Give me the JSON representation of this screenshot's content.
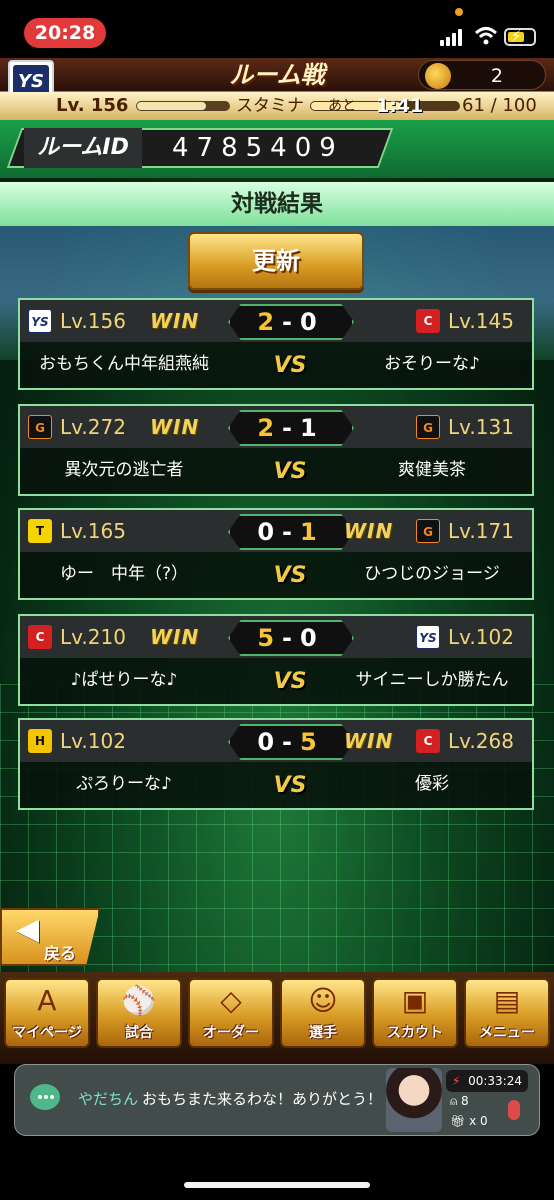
{
  "status_bar": {
    "time": "20:28"
  },
  "header": {
    "title": "ルーム戦",
    "team_emblem": "YS",
    "coin_count": "2",
    "level": "Lv. 156",
    "xp_fraction": 0.75,
    "stamina_label": "スタミナ",
    "stamina_timer_prefix": "あと",
    "stamina_timer": "1:41",
    "stamina_count": "61 / 100",
    "stamina_fraction": 0.61
  },
  "room": {
    "label": "ルームID",
    "id": "4785409"
  },
  "results": {
    "title": "対戦結果",
    "update_label": "更新",
    "vs_label": "VS",
    "win_label": "WIN"
  },
  "matches": [
    {
      "left": {
        "emblem": "YS",
        "level": "Lv.156",
        "name": "おもちくん中年組燕純"
      },
      "right": {
        "emblem": "C",
        "level": "Lv.145",
        "name": "おそりーな♪"
      },
      "score_left": "2",
      "score_right": "0",
      "winner": "left"
    },
    {
      "left": {
        "emblem": "G",
        "level": "Lv.272",
        "name": "異次元の逃亡者"
      },
      "right": {
        "emblem": "G",
        "level": "Lv.131",
        "name": "爽健美茶"
      },
      "score_left": "2",
      "score_right": "1",
      "winner": "left"
    },
    {
      "left": {
        "emblem": "T",
        "level": "Lv.165",
        "name": "ゆー　中年（?）"
      },
      "right": {
        "emblem": "G",
        "level": "Lv.171",
        "name": "ひつじのジョージ"
      },
      "score_left": "0",
      "score_right": "1",
      "winner": "right"
    },
    {
      "left": {
        "emblem": "C",
        "level": "Lv.210",
        "name": "♪ぱせりーな♪"
      },
      "right": {
        "emblem": "YS",
        "level": "Lv.102",
        "name": "サイニーしか勝たん"
      },
      "score_left": "5",
      "score_right": "0",
      "winner": "left"
    },
    {
      "left": {
        "emblem": "H",
        "level": "Lv.102",
        "name": "ぷろりーな♪"
      },
      "right": {
        "emblem": "C",
        "level": "Lv.268",
        "name": "優彩"
      },
      "score_left": "0",
      "score_right": "5",
      "winner": "right"
    }
  ],
  "back_label": "戻る",
  "nav": [
    {
      "label": "マイページ",
      "icon": "A"
    },
    {
      "label": "試合",
      "icon": "⚾"
    },
    {
      "label": "オーダー",
      "icon": "◇"
    },
    {
      "label": "選手",
      "icon": "☺"
    },
    {
      "label": "スカウト",
      "icon": "▣"
    },
    {
      "label": "メニュー",
      "icon": "▤"
    }
  ],
  "live": {
    "commenter": "やだちん",
    "comment": "おもちまた来るわな！ありがとう！",
    "elapsed": "00:33:24",
    "viewers": "8",
    "gifts": "x 0"
  },
  "colors": {
    "win_gold": "#f3d25a",
    "field_green": "#0d4a22",
    "accent_green": "#8fe0a0"
  }
}
